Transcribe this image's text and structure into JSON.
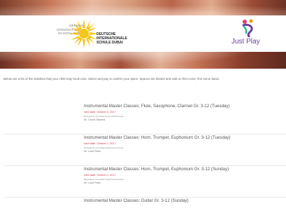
{
  "header": {
    "school_name_en": "GERMAN\nINTERNATIONAL\nSCHOOL DUBAI",
    "school_name_de": "DEUTSCHE\nINTERNATIONALE\nSCHULE DUBAI",
    "partner_logo_text": "Just Play"
  },
  "intro_text": "Below are a list of the activities that your child may book onto. Select and pay to confirm your place. Spaces are limited and sold on first come, first serve basis.",
  "activities": [
    {
      "title": "Instrumental Master Classes: Flute, Saxophone, Clarinet Gr. 3-12 (Tuesday)",
      "date": "Next date: October 3, 2017",
      "venue": "IB Academic City Dubai United Arab Emirates",
      "teacher": "Mr. Carlos Taboera"
    },
    {
      "title": "Instrumental Master Classes: Horn, Trumpet, Euphonium Gr. 3-12 (Tuesday)",
      "date": "Next date: October 1, 2017",
      "venue": "IB Academic City Dubai United Arab Emirates",
      "teacher": "Mr. Luba Petko"
    },
    {
      "title": "Instrumental Master Classes: Horn, Trumpet, Euphonium Gr. 3-12 (Sunday)",
      "date": "Next date: October 1, 2017",
      "venue": "IB Academic City Dubai United Arab Emirates",
      "teacher": "Mr. Luba Petko"
    },
    {
      "title": "Instrumental Master Classes: Guitar Gr. 3-12 (Sunday)",
      "date": "",
      "venue": "",
      "teacher": ""
    }
  ],
  "colors": {
    "date_accent": "#d0394b",
    "brand_purple": "#6a3fa0",
    "sun_yellow": "#f5c518"
  }
}
